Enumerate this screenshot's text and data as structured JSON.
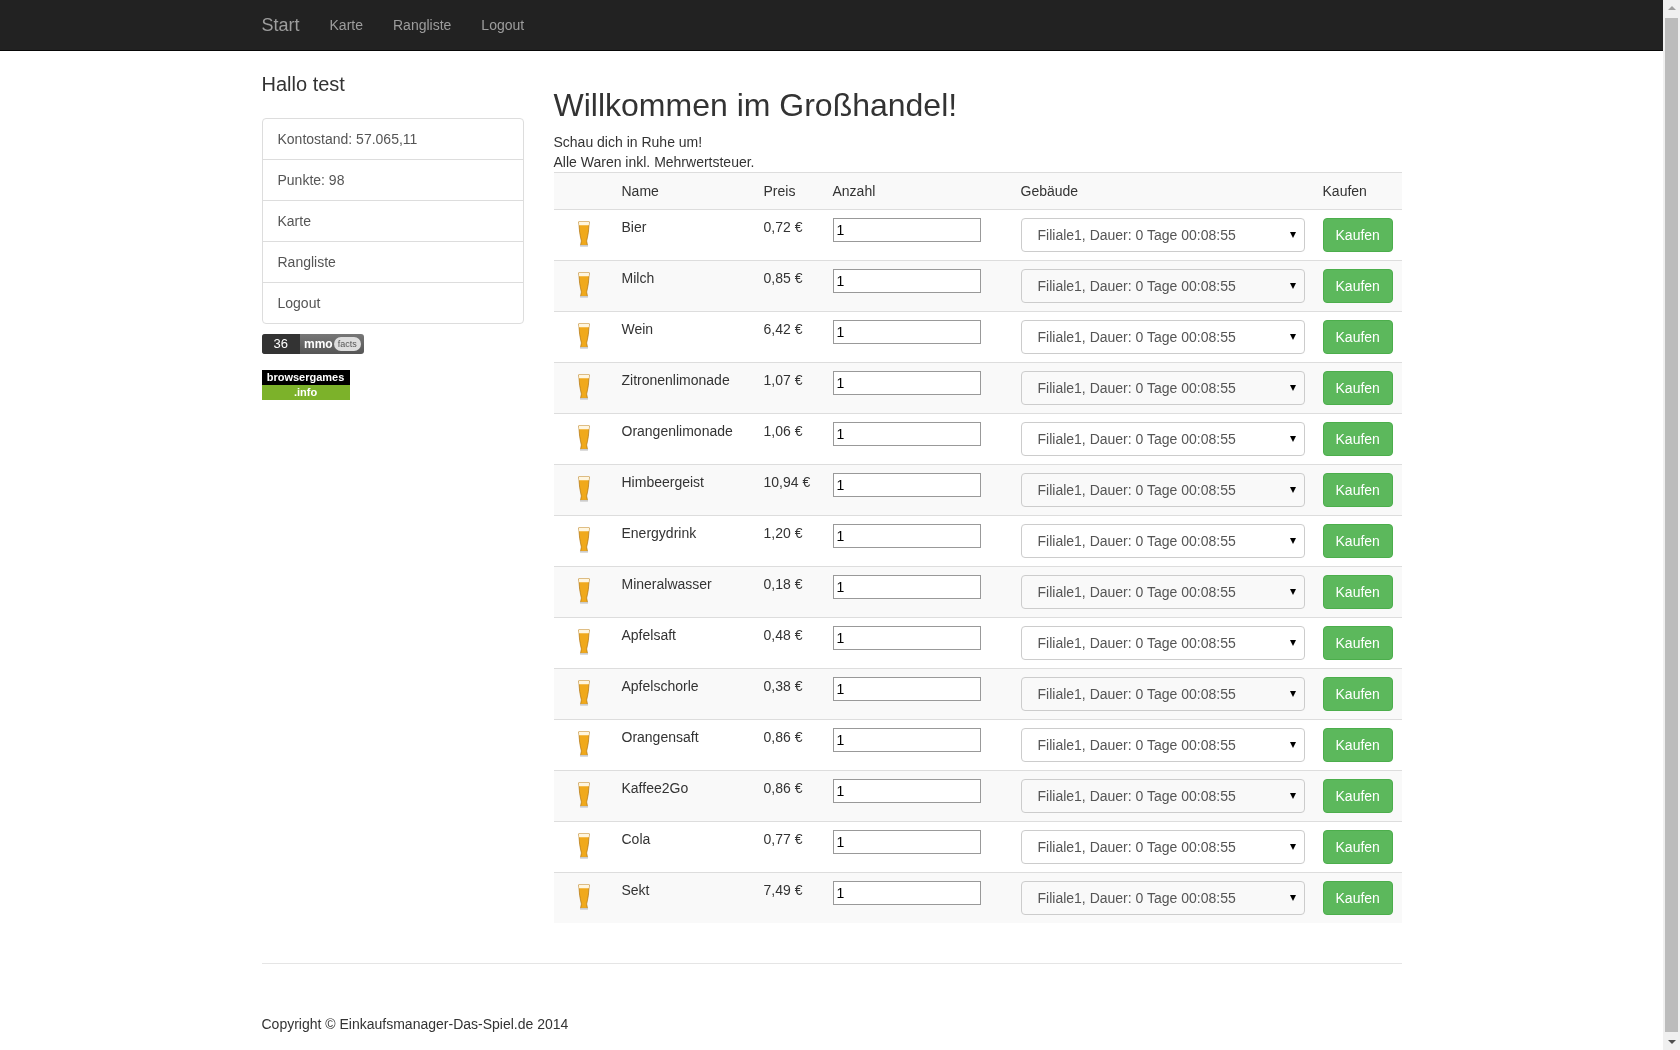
{
  "navbar": {
    "brand": "Start",
    "links": [
      "Karte",
      "Rangliste",
      "Logout"
    ]
  },
  "sidebar": {
    "greeting": "Hallo test",
    "items": [
      "Kontostand: 57.065,11",
      "Punkte: 98",
      "Karte",
      "Rangliste",
      "Logout"
    ],
    "mmo_badge": {
      "count": "36",
      "word": "mmo",
      "tag": "facts"
    },
    "browsergames_badge": {
      "top": "browsergames",
      "bottom": ".info"
    }
  },
  "main": {
    "title": "Willkommen im Großhandel!",
    "intro": [
      "Schau dich in Ruhe um!",
      "Alle Waren inkl. Mehrwertsteuer."
    ]
  },
  "table": {
    "columns": [
      "Name",
      "Preis",
      "Anzahl",
      "Gebäude",
      "Kaufen"
    ],
    "rows": [
      {
        "name": "Bier",
        "price": "0,72 €",
        "amount": "1",
        "building": "Filiale1, Dauer: 0 Tage 00:08:55",
        "button": "Kaufen"
      },
      {
        "name": "Milch",
        "price": "0,85 €",
        "amount": "1",
        "building": "Filiale1, Dauer: 0 Tage 00:08:55",
        "button": "Kaufen"
      },
      {
        "name": "Wein",
        "price": "6,42 €",
        "amount": "1",
        "building": "Filiale1, Dauer: 0 Tage 00:08:55",
        "button": "Kaufen"
      },
      {
        "name": "Zitronenlimonade",
        "price": "1,07 €",
        "amount": "1",
        "building": "Filiale1, Dauer: 0 Tage 00:08:55",
        "button": "Kaufen"
      },
      {
        "name": "Orangenlimonade",
        "price": "1,06 €",
        "amount": "1",
        "building": "Filiale1, Dauer: 0 Tage 00:08:55",
        "button": "Kaufen"
      },
      {
        "name": "Himbeergeist",
        "price": "10,94 €",
        "amount": "1",
        "building": "Filiale1, Dauer: 0 Tage 00:08:55",
        "button": "Kaufen"
      },
      {
        "name": "Energydrink",
        "price": "1,20 €",
        "amount": "1",
        "building": "Filiale1, Dauer: 0 Tage 00:08:55",
        "button": "Kaufen"
      },
      {
        "name": "Mineralwasser",
        "price": "0,18 €",
        "amount": "1",
        "building": "Filiale1, Dauer: 0 Tage 00:08:55",
        "button": "Kaufen"
      },
      {
        "name": "Apfelsaft",
        "price": "0,48 €",
        "amount": "1",
        "building": "Filiale1, Dauer: 0 Tage 00:08:55",
        "button": "Kaufen"
      },
      {
        "name": "Apfelschorle",
        "price": "0,38 €",
        "amount": "1",
        "building": "Filiale1, Dauer: 0 Tage 00:08:55",
        "button": "Kaufen"
      },
      {
        "name": "Orangensaft",
        "price": "0,86 €",
        "amount": "1",
        "building": "Filiale1, Dauer: 0 Tage 00:08:55",
        "button": "Kaufen"
      },
      {
        "name": "Kaffee2Go",
        "price": "0,86 €",
        "amount": "1",
        "building": "Filiale1, Dauer: 0 Tage 00:08:55",
        "button": "Kaufen"
      },
      {
        "name": "Cola",
        "price": "0,77 €",
        "amount": "1",
        "building": "Filiale1, Dauer: 0 Tage 00:08:55",
        "button": "Kaufen"
      },
      {
        "name": "Sekt",
        "price": "7,49 €",
        "amount": "1",
        "building": "Filiale1, Dauer: 0 Tage 00:08:55",
        "button": "Kaufen"
      }
    ]
  },
  "footer": {
    "copyright": "Copyright © Einkaufsmanager-Das-Spiel.de 2014"
  }
}
